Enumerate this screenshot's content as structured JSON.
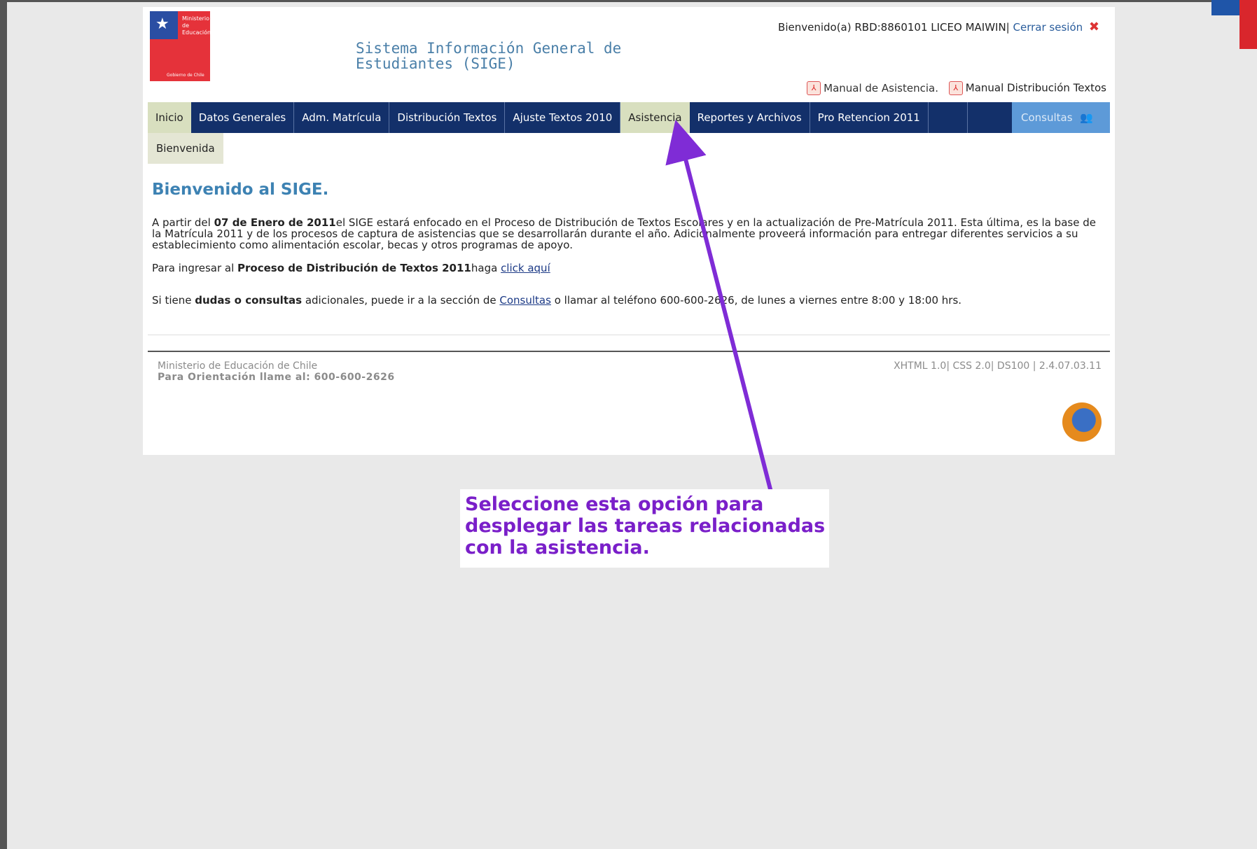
{
  "header": {
    "logo_top": "Ministerio de Educación",
    "logo_bottom": "Gobierno de Chile",
    "system_title_line1": "Sistema Información General de",
    "system_title_line2": "Estudiantes (SIGE)",
    "welcome_text": "Bienvenido(a) RBD:8860101  LICEO MAIWIN|",
    "logout_label": "Cerrar sesión",
    "manual_asistencia": "Manual de Asistencia.",
    "manual_textos": "Manual Distribución Textos"
  },
  "nav": {
    "items": [
      {
        "label": "Inicio"
      },
      {
        "label": "Datos Generales"
      },
      {
        "label": "Adm. Matrícula"
      },
      {
        "label": "Distribución Textos"
      },
      {
        "label": "Ajuste Textos 2010"
      },
      {
        "label": "Asistencia"
      },
      {
        "label": "Reportes y Archivos"
      },
      {
        "label": "Pro Retencion 2011"
      }
    ],
    "consultas": "Consultas"
  },
  "subnav": {
    "label": "Bienvenida"
  },
  "main": {
    "heading": "Bienvenido al SIGE.",
    "p1_a": "A partir del ",
    "p1_date": "07 de Enero de 2011",
    "p1_b": "el SIGE estará enfocado en el Proceso de Distribución de Textos Escolares y en la actualización de Pre-Matrícula 2011. Esta última, es la base de la Matrícula 2011 y de los procesos de captura de asistencias que se desarrollarán durante el año. Adicionalmente proveerá información para entregar diferentes servicios a su establecimiento como alimentación escolar, becas y otros programas de apoyo.",
    "p2_a": "Para ingresar al ",
    "p2_b": "Proceso de Distribución de Textos 2011",
    "p2_c": "haga ",
    "p2_link": "click aquí",
    "p3_a": "Si tiene ",
    "p3_b": "dudas o consultas",
    "p3_c": "  adicionales, puede ir a la sección de ",
    "p3_link": "Consultas",
    "p3_d": " o llamar al teléfono 600-600-2626, de lunes a viernes entre 8:00 y 18:00 hrs."
  },
  "footer": {
    "left_line1": "Ministerio de Educación de Chile",
    "left_line2": "Para Orientación llame al: 600-600-2626",
    "right": "XHTML 1.0| CSS 2.0| DS100 | 2.4.07.03.11"
  },
  "annotation": {
    "line1": "Seleccione esta opción para",
    "line2": "desplegar las tareas relacionadas",
    "line3": "con la asistencia.",
    "color": "#7a1fc9"
  }
}
